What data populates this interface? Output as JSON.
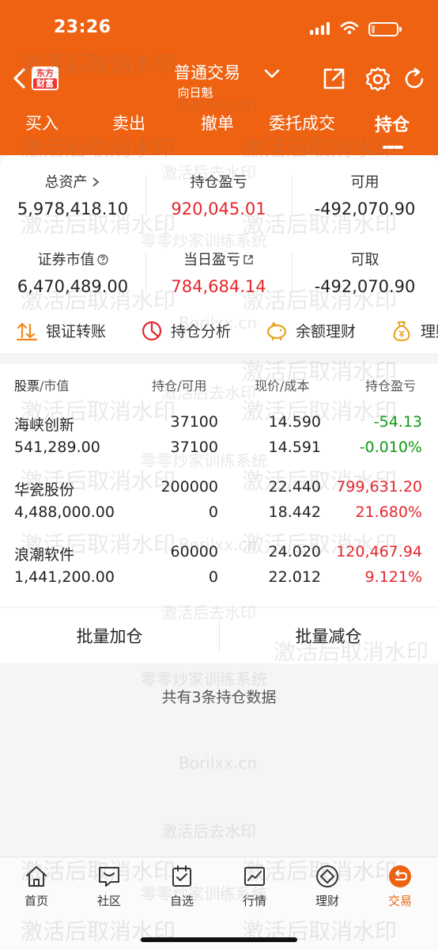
{
  "status_bar": {
    "time": "23:26"
  },
  "nav": {
    "title": "普通交易",
    "subtitle": "向日魁",
    "logo_line1": "东方",
    "logo_line2": "财富"
  },
  "tabs": [
    "买入",
    "卖出",
    "撤单",
    "委托成交",
    "持仓"
  ],
  "active_tab": "持仓",
  "summary": {
    "total_assets": {
      "label": "总资产",
      "value": "5,978,418.10"
    },
    "position_pnl": {
      "label": "持仓盈亏",
      "value": "920,045.01"
    },
    "available": {
      "label": "可用",
      "value": "-492,070.90"
    },
    "market_value": {
      "label": "证券市值",
      "value": "6,470,489.00"
    },
    "daily_pnl": {
      "label": "当日盈亏",
      "value": "784,684.14"
    },
    "withdrawable": {
      "label": "可取",
      "value": "-492,070.90"
    }
  },
  "quick_actions": [
    "银证转账",
    "持仓分析",
    "余额理财",
    "理财"
  ],
  "holdings_header": {
    "col1a": "股票",
    "col1b": "/市值",
    "col2a": "持仓",
    "col2b": "/可用",
    "col3a": "现价",
    "col3b": "/成本",
    "col4": "持仓盈亏"
  },
  "holdings": [
    {
      "name": "海峡创新",
      "market_value": "541,289.00",
      "position": "37100",
      "available": "37100",
      "price": "14.590",
      "cost": "14.591",
      "pnl": "-54.13",
      "pnl_pct": "-0.010%",
      "pnl_color": "green"
    },
    {
      "name": "华瓷股份",
      "market_value": "4,488,000.00",
      "position": "200000",
      "available": "0",
      "price": "22.440",
      "cost": "18.442",
      "pnl": "799,631.20",
      "pnl_pct": "21.680%",
      "pnl_color": "red"
    },
    {
      "name": "浪潮软件",
      "market_value": "1,441,200.00",
      "position": "60000",
      "available": "0",
      "price": "24.020",
      "cost": "22.012",
      "pnl": "120,467.94",
      "pnl_pct": "9.121%",
      "pnl_color": "red"
    }
  ],
  "batch": {
    "add": "批量加仓",
    "reduce": "批量减仓"
  },
  "note": "共有3条持仓数据",
  "watermarks": {
    "a": "激活后取消水印",
    "b": "激活后去水印",
    "c": "零零炒家训练系统",
    "d": "Borilxx.cn"
  },
  "bottom_nav": [
    "首页",
    "社区",
    "自选",
    "行情",
    "理财",
    "交易"
  ],
  "colors": {
    "brand": "#ee6212",
    "up": "#e4262d",
    "down": "#109a10"
  }
}
